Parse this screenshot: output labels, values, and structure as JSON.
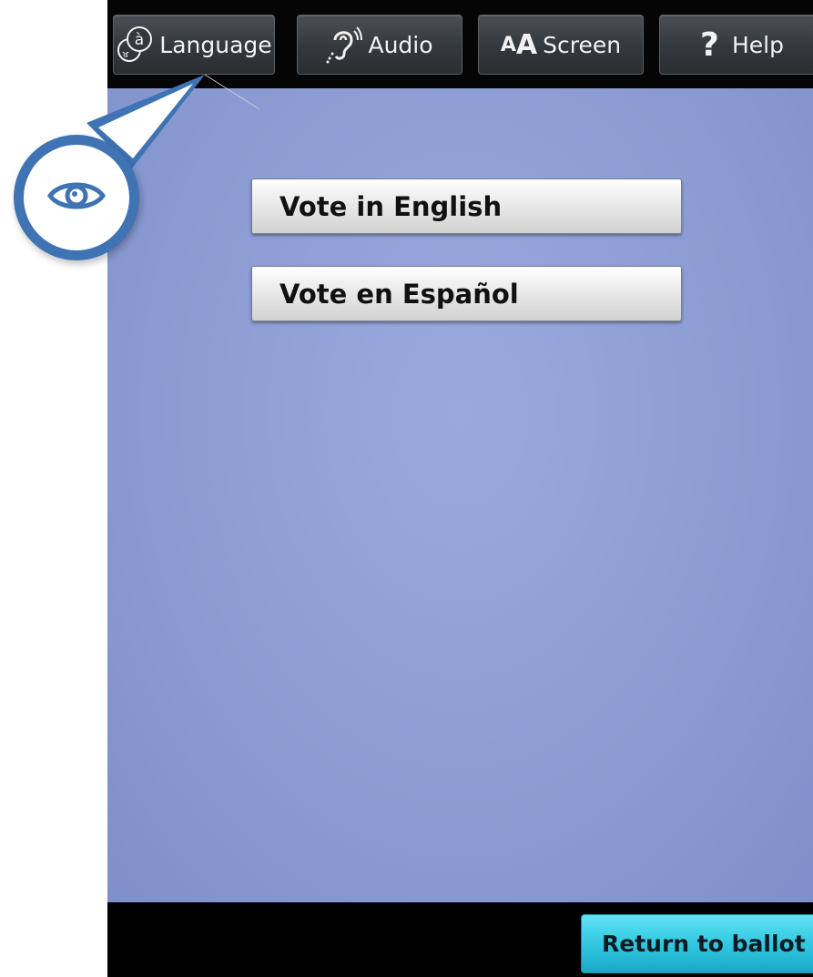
{
  "toolbar": {
    "language": {
      "label": "Language",
      "icon": "language-icon"
    },
    "audio": {
      "label": "Audio",
      "icon": "ear-icon"
    },
    "screen": {
      "label": "Screen",
      "icon_text": "AA",
      "icon": "text-size-icon"
    },
    "help": {
      "label": "Help",
      "icon_text": "?",
      "icon": "help-icon"
    }
  },
  "main": {
    "options": [
      "Vote in English",
      "Vote en Español"
    ]
  },
  "footer": {
    "return_label": "Return to ballot"
  },
  "callout": {
    "icon": "eye-icon"
  },
  "colors": {
    "accent_blue": "#3f73b4",
    "background": "#8f9fd6",
    "return_button": "#2ec5df"
  }
}
